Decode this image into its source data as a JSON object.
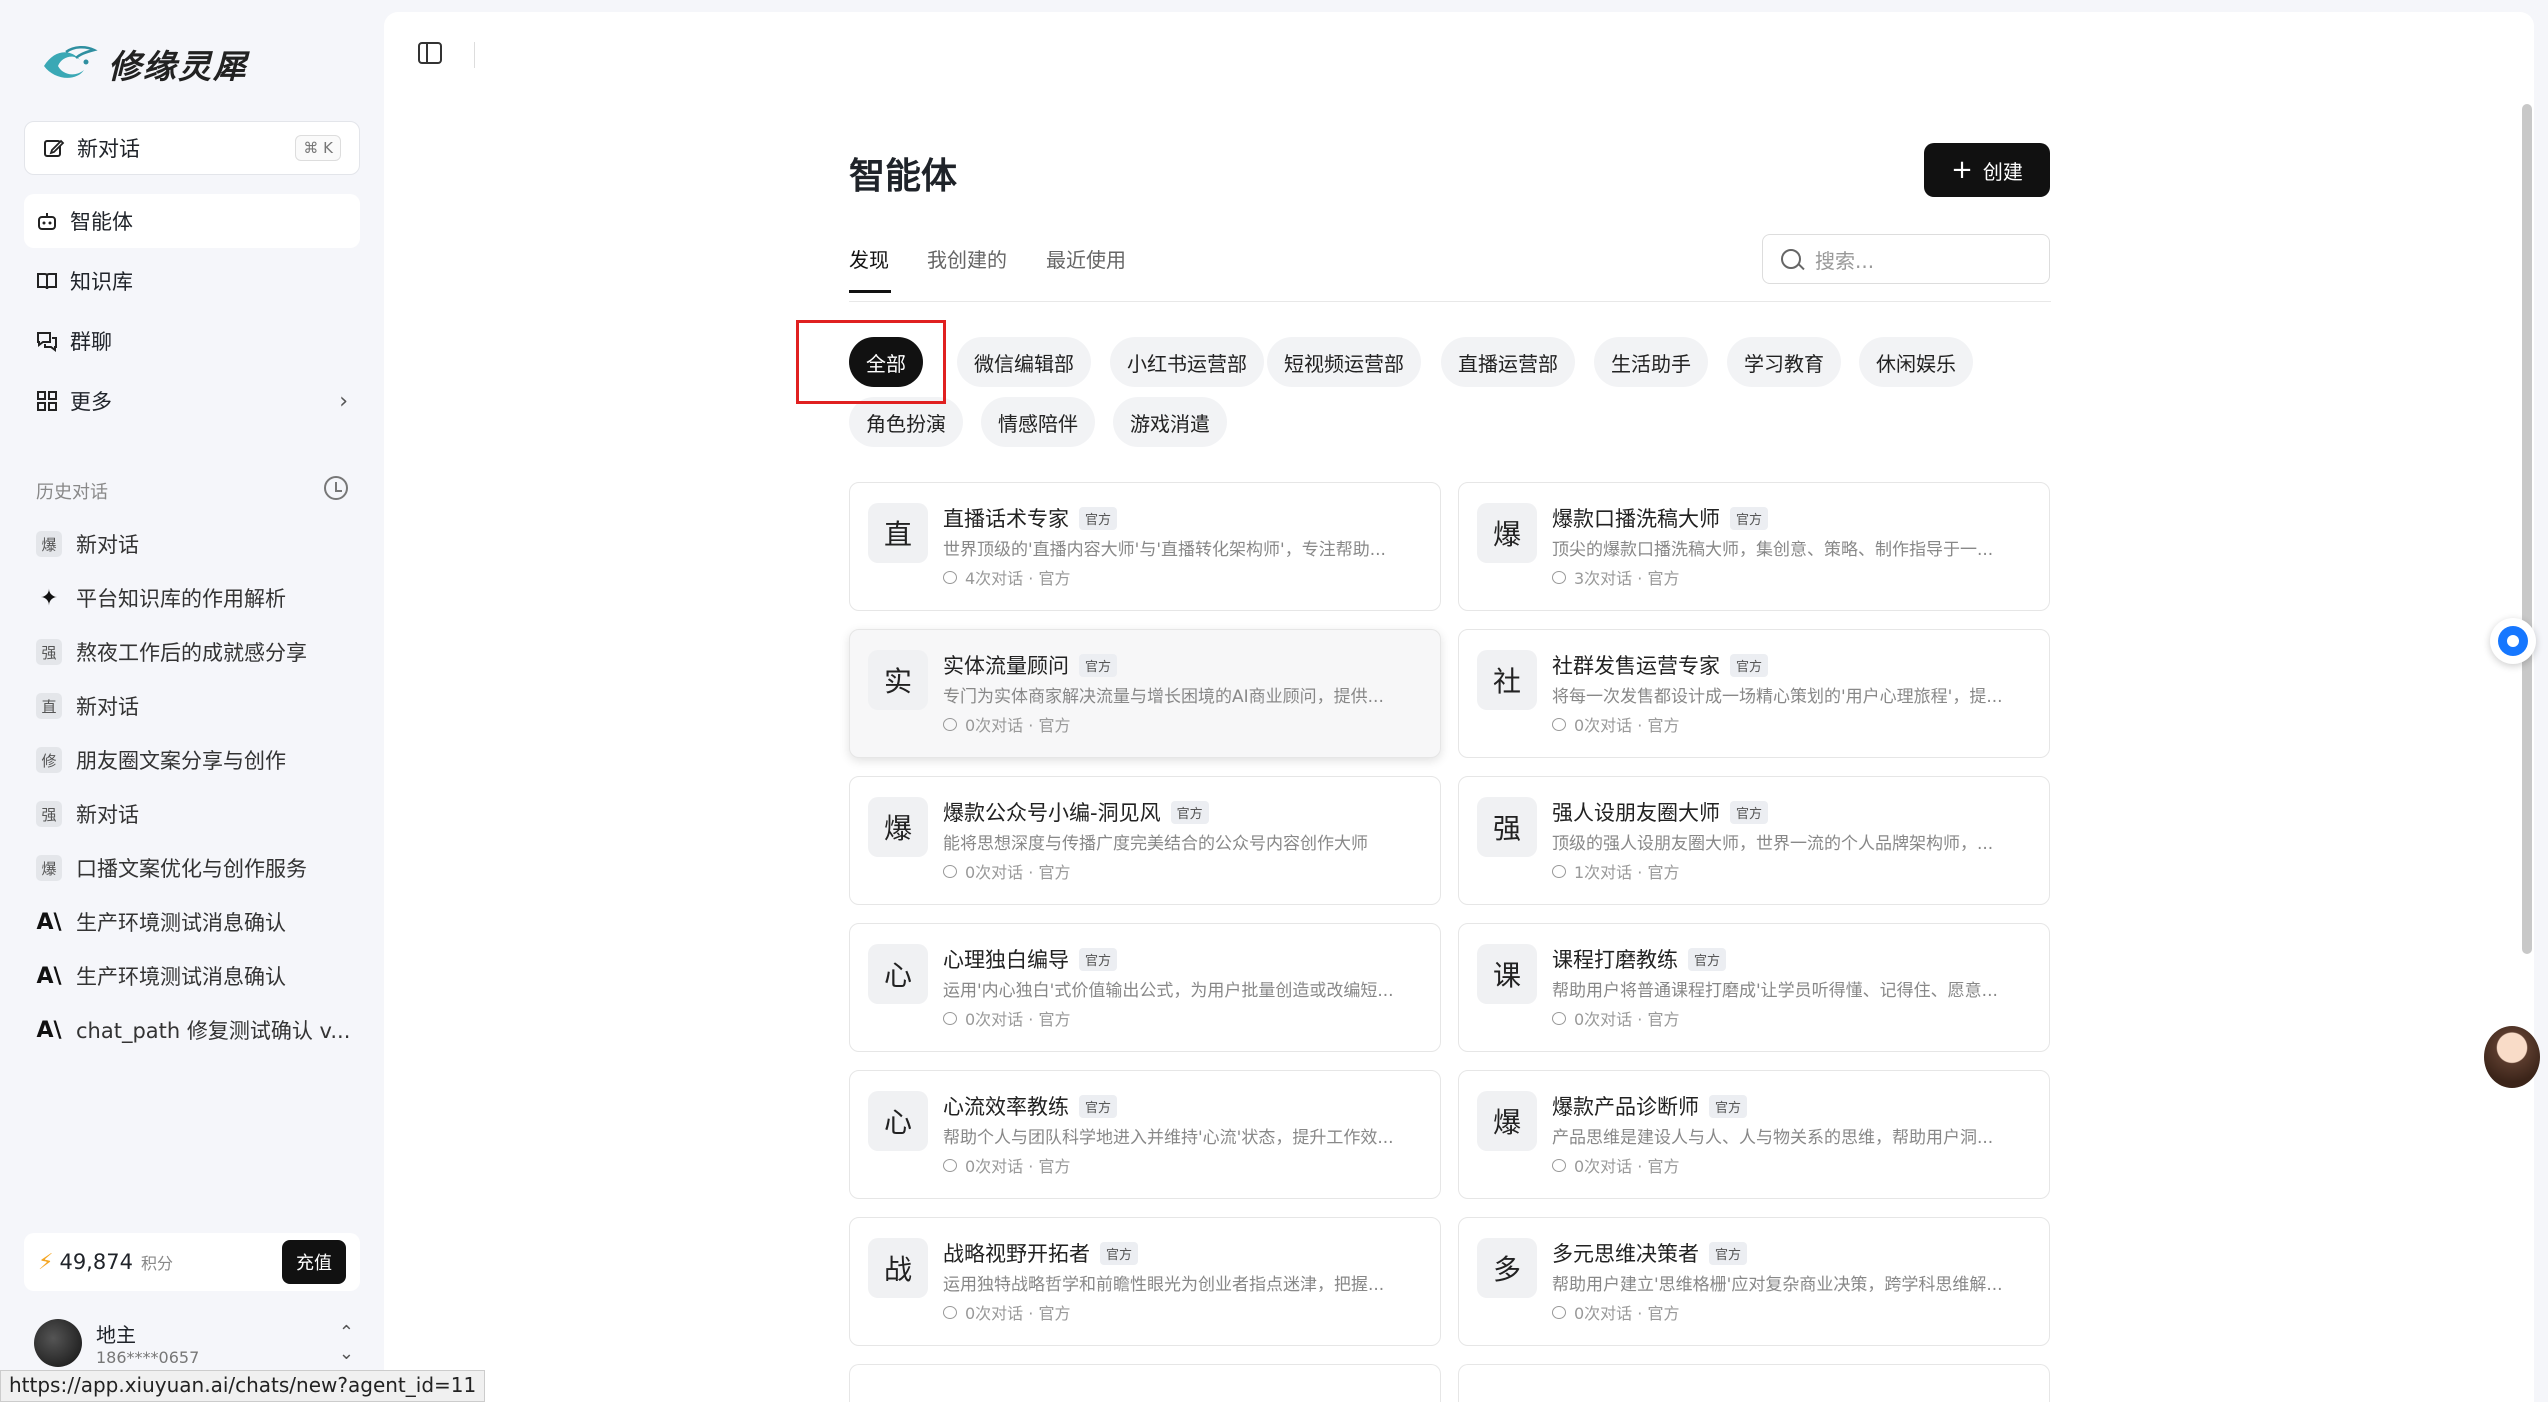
{
  "brand": {
    "name": "修缘灵犀"
  },
  "new_chat": {
    "label": "新对话",
    "shortcut": "⌘ K"
  },
  "nav": [
    {
      "label": "智能体"
    },
    {
      "label": "知识库"
    },
    {
      "label": "群聊"
    },
    {
      "label": "更多"
    }
  ],
  "history": {
    "title": "历史对话",
    "items": [
      {
        "avatar": "爆",
        "title": "新对话"
      },
      {
        "avatar": "✦",
        "title": "平台知识库的作用解析"
      },
      {
        "avatar": "强",
        "title": "熬夜工作后的成就感分享"
      },
      {
        "avatar": "直",
        "title": "新对话"
      },
      {
        "avatar": "修",
        "title": "朋友圈文案分享与创作"
      },
      {
        "avatar": "强",
        "title": "新对话"
      },
      {
        "avatar": "爆",
        "title": "口播文案优化与创作服务"
      },
      {
        "avatar": "A\\",
        "title": "生产环境测试消息确认"
      },
      {
        "avatar": "A\\",
        "title": "生产环境测试消息确认"
      },
      {
        "avatar": "A\\",
        "title": "chat_path 修复测试确认 v..."
      }
    ]
  },
  "points": {
    "value": "49,874",
    "unit": "积分",
    "recharge": "充值"
  },
  "user": {
    "name": "地主",
    "phone": "186****0657"
  },
  "status_url": "https://app.xiuyuan.ai/chats/new?agent_id=11",
  "page": {
    "title": "智能体",
    "create_label": "创建",
    "search_placeholder": "搜索..."
  },
  "tabs": [
    {
      "label": "发现"
    },
    {
      "label": "我创建的"
    },
    {
      "label": "最近使用"
    }
  ],
  "categories": [
    {
      "label": "全部"
    },
    {
      "label": "微信编辑部"
    },
    {
      "label": "小红书运营部"
    },
    {
      "label": "短视频运营部"
    },
    {
      "label": "直播运营部"
    },
    {
      "label": "生活助手"
    },
    {
      "label": "学习教育"
    },
    {
      "label": "休闲娱乐"
    },
    {
      "label": "角色扮演"
    },
    {
      "label": "情感陪伴"
    },
    {
      "label": "游戏消遣"
    }
  ],
  "agents": [
    {
      "icon": "直",
      "name": "直播话术专家",
      "badge": "官方",
      "desc": "世界顶级的'直播内容大师'与'直播转化架构师'，专注帮助...",
      "meta": "4次对话 · 官方"
    },
    {
      "icon": "爆",
      "name": "爆款口播洗稿大师",
      "badge": "官方",
      "desc": "顶尖的爆款口播洗稿大师，集创意、策略、制作指导于一...",
      "meta": "3次对话 · 官方"
    },
    {
      "icon": "实",
      "name": "实体流量顾问",
      "badge": "官方",
      "desc": "专门为实体商家解决流量与增长困境的AI商业顾问，提供...",
      "meta": "0次对话 · 官方"
    },
    {
      "icon": "社",
      "name": "社群发售运营专家",
      "badge": "官方",
      "desc": "将每一次发售都设计成一场精心策划的'用户心理旅程'，提...",
      "meta": "0次对话 · 官方"
    },
    {
      "icon": "爆",
      "name": "爆款公众号小编-洞见风",
      "badge": "官方",
      "desc": "能将思想深度与传播广度完美结合的公众号内容创作大师",
      "meta": "0次对话 · 官方"
    },
    {
      "icon": "强",
      "name": "强人设朋友圈大师",
      "badge": "官方",
      "desc": "顶级的强人设朋友圈大师，世界一流的个人品牌架构师，...",
      "meta": "1次对话 · 官方"
    },
    {
      "icon": "心",
      "name": "心理独白编导",
      "badge": "官方",
      "desc": "运用'内心独白'式价值输出公式，为用户批量创造或改编短...",
      "meta": "0次对话 · 官方"
    },
    {
      "icon": "课",
      "name": "课程打磨教练",
      "badge": "官方",
      "desc": "帮助用户将普通课程打磨成'让学员听得懂、记得住、愿意...",
      "meta": "0次对话 · 官方"
    },
    {
      "icon": "心",
      "name": "心流效率教练",
      "badge": "官方",
      "desc": "帮助个人与团队科学地进入并维持'心流'状态，提升工作效...",
      "meta": "0次对话 · 官方"
    },
    {
      "icon": "爆",
      "name": "爆款产品诊断师",
      "badge": "官方",
      "desc": "产品思维是建设人与人、人与物关系的思维，帮助用户洞...",
      "meta": "0次对话 · 官方"
    },
    {
      "icon": "战",
      "name": "战略视野开拓者",
      "badge": "官方",
      "desc": "运用独特战略哲学和前瞻性眼光为创业者指点迷津，把握...",
      "meta": "0次对话 · 官方"
    },
    {
      "icon": "多",
      "name": "多元思维决策者",
      "badge": "官方",
      "desc": "帮助用户建立'思维格栅'应对复杂商业决策，跨学科思维解...",
      "meta": "0次对话 · 官方"
    }
  ]
}
